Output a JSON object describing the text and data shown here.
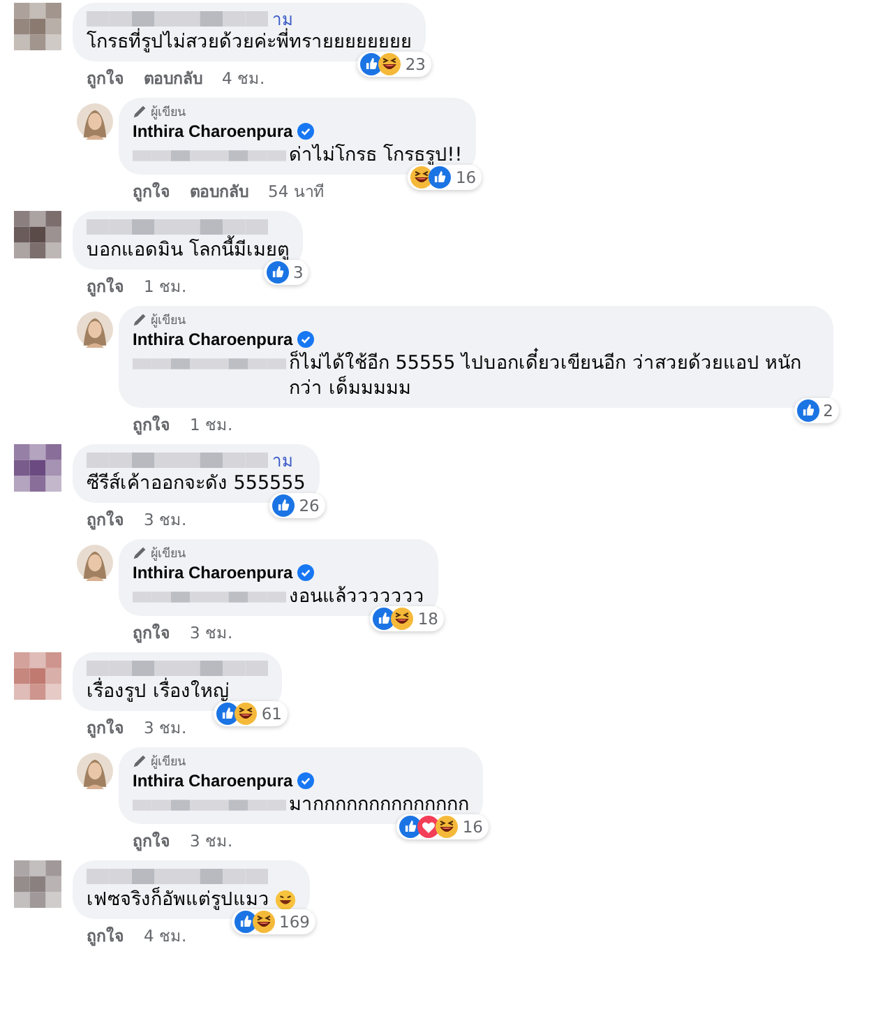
{
  "comments": [
    {
      "kind": "top",
      "name_tail": "าม",
      "text": "โกรธที่รูปไม่สวยด้วยค่ะพี่ทรายยยยยยยย",
      "reactions": [
        {
          "kind": "like"
        },
        {
          "kind": "haha"
        }
      ],
      "count": "23",
      "actions": [
        "ถูกใจ",
        "ตอบกลับ"
      ],
      "time": "4 ชม."
    },
    {
      "kind": "reply",
      "badge": "ผู้เขียน",
      "name": "Inthira Charoenpura",
      "verified": true,
      "blurred_prefix": true,
      "text": "ด่าไม่โกรธ โกรธรูป!!",
      "reactions": [
        {
          "kind": "haha"
        },
        {
          "kind": "like"
        }
      ],
      "count": "16",
      "actions": [
        "ถูกใจ",
        "ตอบกลับ"
      ],
      "time": "54 นาที"
    },
    {
      "kind": "top",
      "text": "บอกแอดมิน โลกนี้มีเมยตู",
      "reactions": [
        {
          "kind": "like"
        }
      ],
      "count": "3",
      "actions": [
        "ถูกใจ"
      ],
      "time": "1 ชม."
    },
    {
      "kind": "reply",
      "badge": "ผู้เขียน",
      "name": "Inthira Charoenpura",
      "verified": true,
      "blurred_prefix": true,
      "text": "ก็ไม่ได้ใช้อีก 55555 ไปบอกเดี๋ยวเขียนอีก ว่าสวยด้วยแอป หนักกว่า เด็มมมมม",
      "reactions": [
        {
          "kind": "like"
        }
      ],
      "count": "2",
      "actions": [
        "ถูกใจ"
      ],
      "time": "1 ชม."
    },
    {
      "kind": "top",
      "name_tail": "าม",
      "text": "ซีรีส์เค้าออกจะดัง 555555",
      "reactions": [
        {
          "kind": "like"
        }
      ],
      "count": "26",
      "actions": [
        "ถูกใจ"
      ],
      "time": "3 ชม."
    },
    {
      "kind": "reply",
      "badge": "ผู้เขียน",
      "name": "Inthira Charoenpura",
      "verified": true,
      "blurred_prefix": true,
      "text": "งอนแล้ววววววว",
      "reactions": [
        {
          "kind": "like"
        },
        {
          "kind": "haha"
        }
      ],
      "count": "18",
      "actions": [
        "ถูกใจ"
      ],
      "time": "3 ชม."
    },
    {
      "kind": "top",
      "text": "เรื่องรูป เรื่องใหญ่",
      "reactions": [
        {
          "kind": "like"
        },
        {
          "kind": "haha"
        }
      ],
      "count": "61",
      "actions": [
        "ถูกใจ"
      ],
      "time": "3 ชม."
    },
    {
      "kind": "reply",
      "badge": "ผู้เขียน",
      "name": "Inthira Charoenpura",
      "verified": true,
      "blurred_prefix": true,
      "text": "มากกกกกกกกกกกกกก",
      "reactions": [
        {
          "kind": "like"
        },
        {
          "kind": "love"
        },
        {
          "kind": "haha"
        }
      ],
      "count": "16",
      "actions": [
        "ถูกใจ"
      ],
      "time": "3 ชม."
    },
    {
      "kind": "top",
      "text": "เฟซจริงก็อัพแต่รูปแมว",
      "emoji": true,
      "reactions": [
        {
          "kind": "like"
        },
        {
          "kind": "haha"
        }
      ],
      "count": "169",
      "actions": [
        "ถูกใจ"
      ],
      "time": "4 ชม."
    }
  ]
}
